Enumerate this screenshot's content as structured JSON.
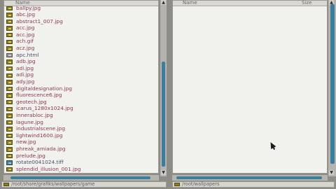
{
  "left_panel": {
    "columns": {
      "name": "Name"
    },
    "files": [
      {
        "name": "ballpy.jpg",
        "icon": "folder-icon"
      },
      {
        "name": "abc.jpg",
        "icon": "image-file-icon"
      },
      {
        "name": "abstract1_007.jpg",
        "icon": "image-file-icon"
      },
      {
        "name": "acc.jpg",
        "icon": "image-file-icon"
      },
      {
        "name": "acc.jpg",
        "icon": "image-file-icon"
      },
      {
        "name": "ach.gif",
        "icon": "image-file-icon"
      },
      {
        "name": "acz.jpg",
        "icon": "image-file-icon"
      },
      {
        "name": "apc.html",
        "icon": "document-icon"
      },
      {
        "name": "adb.jpg",
        "icon": "image-file-icon"
      },
      {
        "name": "adi.jpg",
        "icon": "image-file-icon"
      },
      {
        "name": "adi.jpg",
        "icon": "image-file-icon"
      },
      {
        "name": "ady.jpg",
        "icon": "image-file-icon"
      },
      {
        "name": "digitaldesignation.jpg",
        "icon": "image-file-icon"
      },
      {
        "name": "fluorescence6.jpg",
        "icon": "image-file-icon"
      },
      {
        "name": "geotech.jpg",
        "icon": "image-file-icon"
      },
      {
        "name": "icarus_1280x1024.jpg",
        "icon": "image-file-icon"
      },
      {
        "name": "innerabloc.jpg",
        "icon": "image-file-icon"
      },
      {
        "name": "lagune.jpg",
        "icon": "image-file-icon"
      },
      {
        "name": "industrialscene.jpg",
        "icon": "image-file-icon"
      },
      {
        "name": "lightwind1600.jpg",
        "icon": "image-file-icon"
      },
      {
        "name": "new.jpg",
        "icon": "image-file-icon"
      },
      {
        "name": "phreak_amiada.jpg",
        "icon": "image-file-icon"
      },
      {
        "name": "prelude.jpg",
        "icon": "image-file-icon"
      },
      {
        "name": "rotate0041024.tiff",
        "icon": "blue-file-icon"
      },
      {
        "name": "splendid_illusion_001.jpg",
        "icon": "image-file-icon"
      }
    ],
    "path": "/root/share/grafiks/wallpapers/game"
  },
  "right_panel": {
    "columns": {
      "name": "Name",
      "size": "Size"
    },
    "path": "/root/wallpapers"
  }
}
